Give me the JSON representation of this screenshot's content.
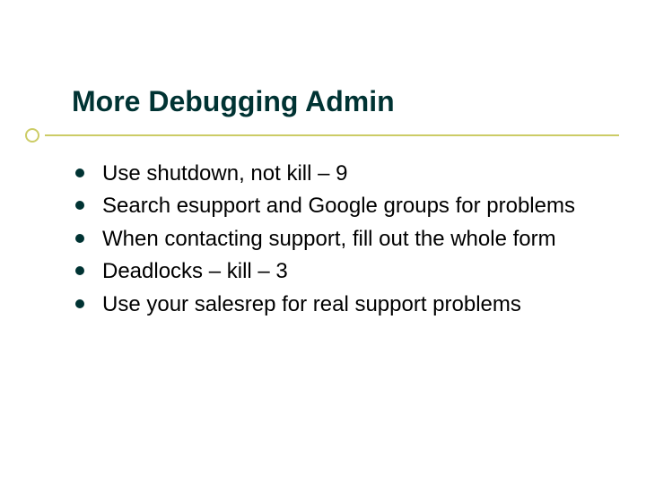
{
  "slide": {
    "title": "More Debugging Admin",
    "bullets": [
      "Use shutdown, not kill – 9",
      "Search esupport and Google groups for problems",
      "When contacting support, fill out the whole form",
      "Deadlocks – kill – 3",
      "Use your salesrep for real support problems"
    ]
  },
  "colors": {
    "title": "#003333",
    "accent": "#cccc66",
    "bullet": "#003333"
  }
}
